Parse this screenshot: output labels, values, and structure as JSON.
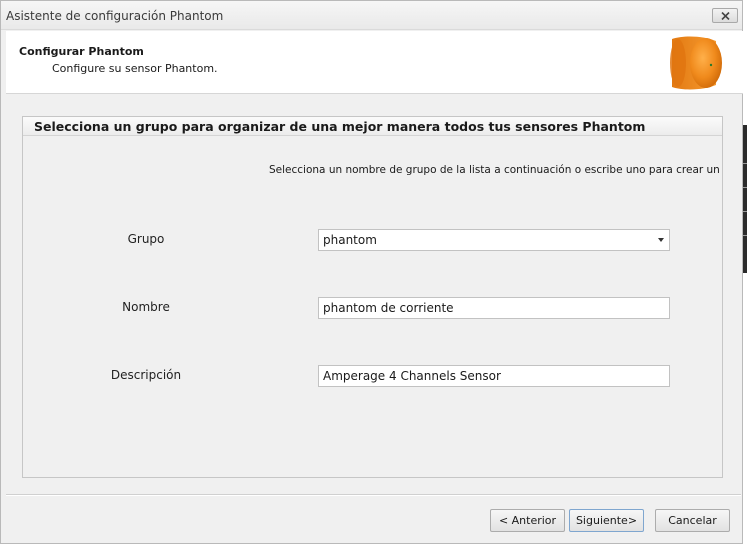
{
  "window": {
    "title": "Asistente de configuración Phantom"
  },
  "header": {
    "title": "Configurar Phantom",
    "subtitle": "Configure su sensor Phantom."
  },
  "group_panel": {
    "title": "Selecciona un grupo para organizar de una mejor manera todos tus sensores Phantom",
    "hint": "Selecciona un nombre de grupo de la lista a continuación o escribe uno para crear un grupo nuevo"
  },
  "form": {
    "group": {
      "label": "Grupo",
      "value": "phantom"
    },
    "name": {
      "label": "Nombre",
      "value": "phantom de corriente"
    },
    "description": {
      "label": "Descripción",
      "value": "Amperage 4 Channels Sensor"
    }
  },
  "buttons": {
    "back": "< Anterior",
    "next": "Siguiente>",
    "cancel": "Cancelar"
  },
  "icons": {
    "close": "close-icon",
    "logo": "phantom-sensor-logo",
    "dropdown": "chevron-down-icon"
  },
  "colors": {
    "logo_orange": "#f08a1c",
    "default_button_border": "#7fa6cf"
  }
}
